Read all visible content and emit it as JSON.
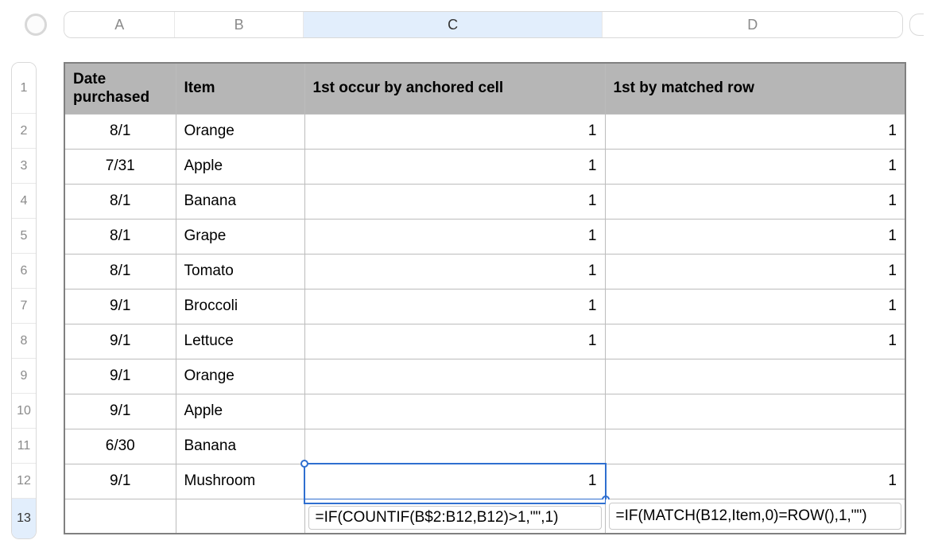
{
  "column_labels": {
    "A": "A",
    "B": "B",
    "C": "C",
    "D": "D"
  },
  "selected_column": "C",
  "selected_row": "13",
  "row_labels": [
    "1",
    "2",
    "3",
    "4",
    "5",
    "6",
    "7",
    "8",
    "9",
    "10",
    "11",
    "12",
    "13"
  ],
  "headers": {
    "A": "Date purchased",
    "B": "Item",
    "C": "1st occur by anchored cell",
    "D": "1st by matched row"
  },
  "rows": [
    {
      "date": "8/1",
      "item": "Orange",
      "c": "1",
      "d": "1"
    },
    {
      "date": "7/31",
      "item": "Apple",
      "c": "1",
      "d": "1"
    },
    {
      "date": "8/1",
      "item": "Banana",
      "c": "1",
      "d": "1"
    },
    {
      "date": "8/1",
      "item": "Grape",
      "c": "1",
      "d": "1"
    },
    {
      "date": "8/1",
      "item": "Tomato",
      "c": "1",
      "d": "1"
    },
    {
      "date": "9/1",
      "item": "Broccoli",
      "c": "1",
      "d": "1"
    },
    {
      "date": "9/1",
      "item": "Lettuce",
      "c": "1",
      "d": "1"
    },
    {
      "date": "9/1",
      "item": "Orange",
      "c": "",
      "d": ""
    },
    {
      "date": "9/1",
      "item": "Apple",
      "c": "",
      "d": ""
    },
    {
      "date": "6/30",
      "item": "Banana",
      "c": "",
      "d": ""
    },
    {
      "date": "9/1",
      "item": "Mushroom",
      "c": "1",
      "d": "1"
    }
  ],
  "active_cell": {
    "ref": "C12",
    "display": "1"
  },
  "formulas": {
    "C13": "=IF(COUNTIF(B$2:B12,B12)>1,\"\",1)",
    "D13": "=IF(MATCH(B12,Item,0)=ROW(),1,\"\")"
  }
}
